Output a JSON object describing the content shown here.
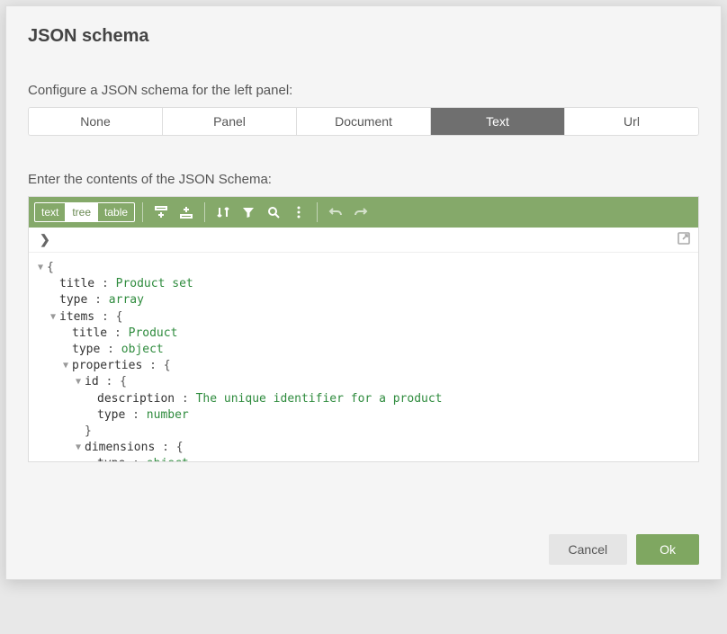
{
  "dialog": {
    "title": "JSON schema",
    "configure_label": "Configure a JSON schema for the left panel:",
    "segments": {
      "none": "None",
      "panel": "Panel",
      "document": "Document",
      "text": "Text",
      "url": "Url",
      "active": "text"
    },
    "contents_label": "Enter the contents of the JSON Schema:"
  },
  "editor": {
    "view_tabs": {
      "text": "text",
      "tree": "tree",
      "table": "table",
      "active": "tree"
    },
    "tree": [
      {
        "depth": 0,
        "caret": true,
        "text": "{"
      },
      {
        "depth": 1,
        "caret": false,
        "key": "title",
        "sep": " : ",
        "val": "Product set"
      },
      {
        "depth": 1,
        "caret": false,
        "key": "type",
        "sep": " : ",
        "val": "array"
      },
      {
        "depth": 1,
        "caret": true,
        "key": "items",
        "sep": " : ",
        "brace": "{"
      },
      {
        "depth": 2,
        "caret": false,
        "key": "title",
        "sep": " : ",
        "val": "Product"
      },
      {
        "depth": 2,
        "caret": false,
        "key": "type",
        "sep": " : ",
        "val": "object"
      },
      {
        "depth": 2,
        "caret": true,
        "key": "properties",
        "sep": " : ",
        "brace": "{"
      },
      {
        "depth": 3,
        "caret": true,
        "key": "id",
        "sep": " : ",
        "brace": "{"
      },
      {
        "depth": 4,
        "caret": false,
        "key": "description",
        "sep": " : ",
        "val": "The unique identifier for a product"
      },
      {
        "depth": 4,
        "caret": false,
        "key": "type",
        "sep": " : ",
        "val": "number"
      },
      {
        "depth": 3,
        "caret": false,
        "closebrace": "}"
      },
      {
        "depth": 3,
        "caret": true,
        "key": "dimensions",
        "sep": " : ",
        "brace": "{"
      },
      {
        "depth": 4,
        "caret": false,
        "key": "type",
        "sep": " : ",
        "val": "object"
      }
    ]
  },
  "footer": {
    "cancel": "Cancel",
    "ok": "Ok"
  }
}
